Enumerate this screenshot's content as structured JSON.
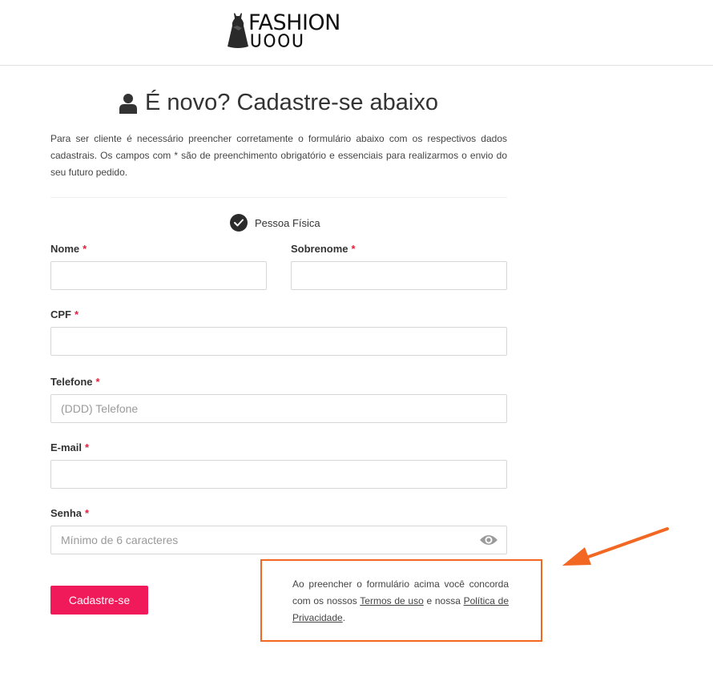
{
  "header": {
    "logo_top": "FASHION",
    "logo_bottom": "UOOU"
  },
  "page": {
    "title": "É novo? Cadastre-se abaixo",
    "intro": "Para ser cliente é necessário preencher corretamente o formulário abaixo com os respectivos dados cadastrais. Os campos com * são de preenchimento obrigatório e essenciais para realizarmos o envio do seu futuro pedido.",
    "person_type": "Pessoa Física"
  },
  "form": {
    "nome_label": "Nome",
    "sobrenome_label": "Sobrenome",
    "cpf_label": "CPF",
    "telefone_label": "Telefone",
    "telefone_placeholder": "(DDD) Telefone",
    "email_label": "E-mail",
    "senha_label": "Senha",
    "senha_placeholder": "Mínimo de 6 caracteres",
    "required_mark": "*",
    "submit_label": "Cadastre-se"
  },
  "terms": {
    "text_before": "Ao preencher o formulário acima você concorda com os nossos ",
    "terms_link": "Termos de uso",
    "text_middle": " e nossa ",
    "privacy_link": "Política de Privacidade",
    "text_after": "."
  },
  "colors": {
    "accent": "#f0195a",
    "annotation": "#f26722",
    "required": "#e01e3c"
  }
}
